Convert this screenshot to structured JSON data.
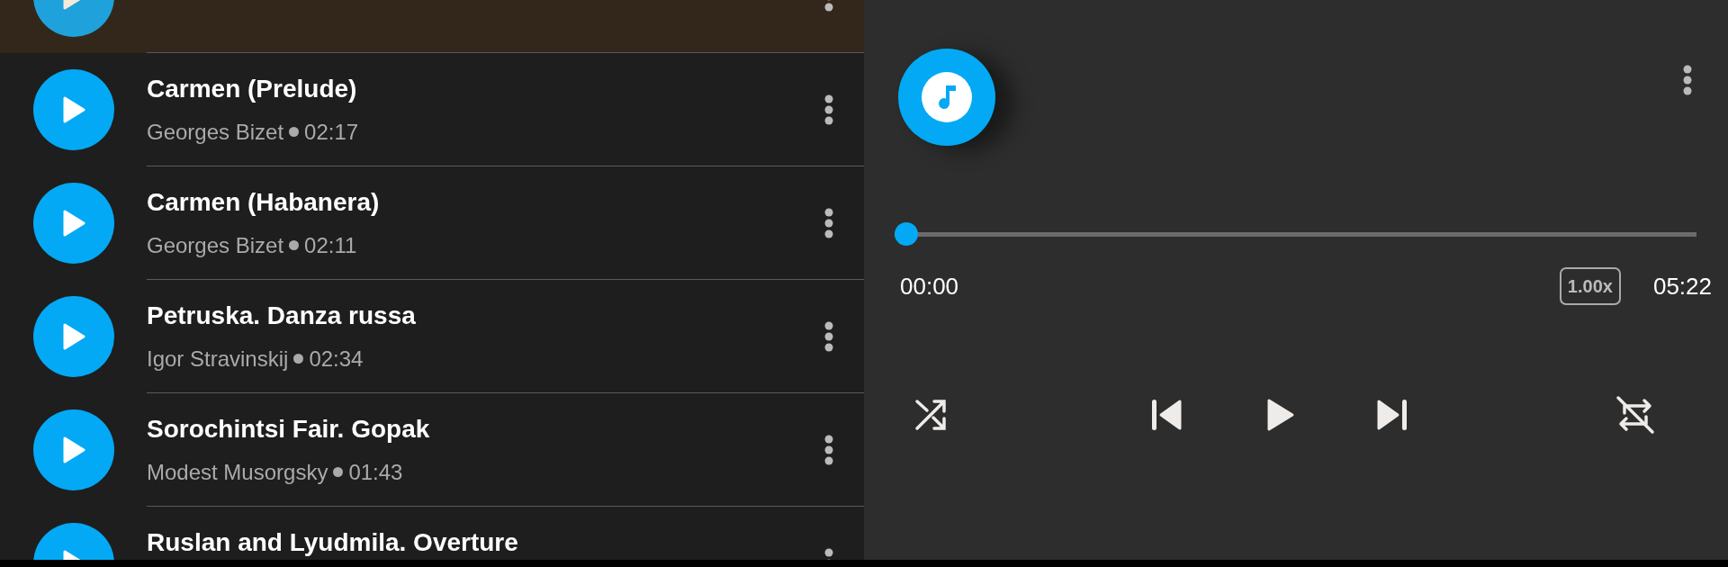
{
  "playlist": [
    {
      "selected": true
    },
    {
      "title": "Carmen (Prelude)",
      "artist": "Georges Bizet",
      "duration": "02:17",
      "selected": false
    },
    {
      "title": "Carmen (Habanera)",
      "artist": "Georges Bizet",
      "duration": "02:11",
      "selected": false
    },
    {
      "title": "Petruska. Danza russa",
      "artist": "Igor Stravinskij",
      "duration": "02:34",
      "selected": false
    },
    {
      "title": "Sorochintsi Fair. Gopak",
      "artist": "Modest Musorgsky",
      "duration": "01:43",
      "selected": false
    },
    {
      "title": "Ruslan and Lyudmila. Overture",
      "selected": false
    }
  ],
  "player": {
    "progress": {
      "level": 0
    },
    "elapsed": "00:00",
    "speed": "1.00x",
    "total": "05:22",
    "shuffle": false,
    "repeat": false
  }
}
